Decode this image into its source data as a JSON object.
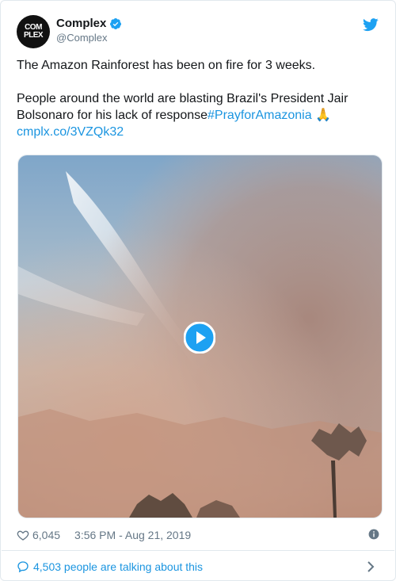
{
  "author": {
    "avatar_line1": "COM",
    "avatar_line2": "PLEX",
    "display_name": "Complex",
    "handle": "@Complex"
  },
  "tweet": {
    "line1": "The Amazon Rainforest has been on fire for 3 weeks.",
    "line2": "People around the world are blasting Brazil's President Jair Bolsonaro for his lack of response",
    "hashtag": "#PrayforAmazonia",
    "emoji": "🙏",
    "link": "cmplx.co/3VZQk32"
  },
  "meta": {
    "likes": "6,045",
    "timestamp": "3:56 PM - Aug 21, 2019"
  },
  "footer": {
    "talking": "4,503 people are talking about this"
  },
  "colors": {
    "accent": "#1b95e0",
    "verified": "#1da1f2",
    "text": "#14171a",
    "muted": "#657786"
  }
}
